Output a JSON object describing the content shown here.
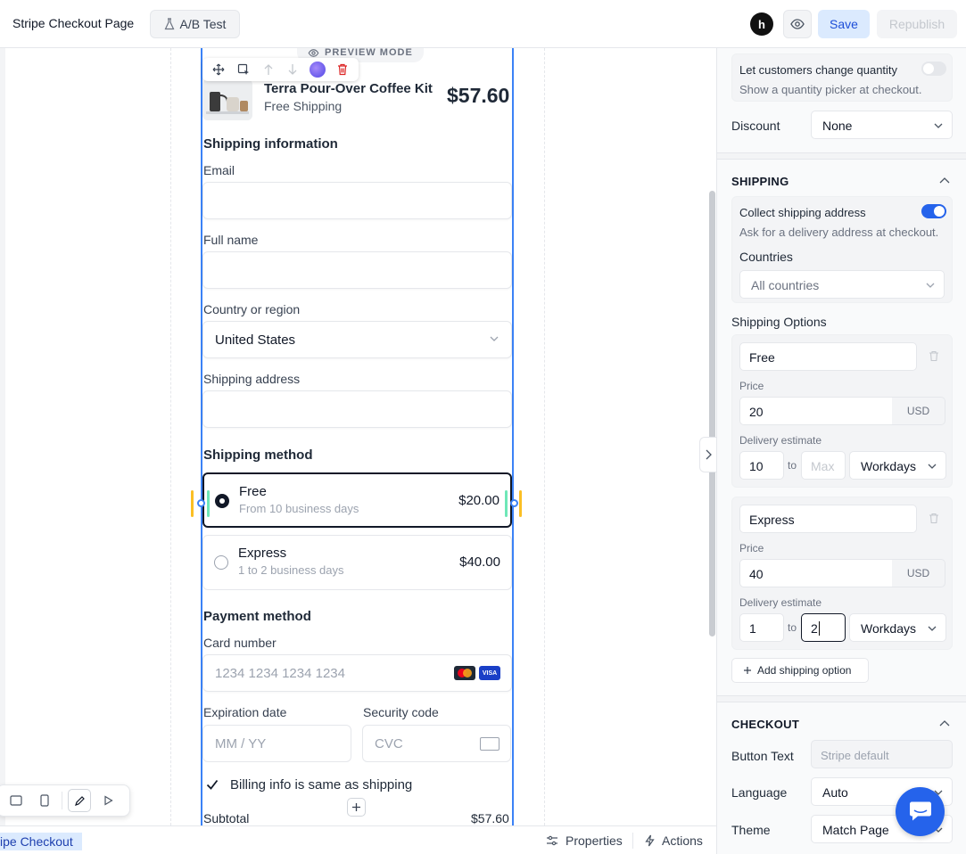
{
  "topbar": {
    "title": "Stripe Checkout Page",
    "ab_test_label": "A/B Test",
    "logo_glyph": "h",
    "save_label": "Save",
    "republish_label": "Republish"
  },
  "canvas": {
    "preview_badge": "PREVIEW MODE",
    "product": {
      "name": "Terra Pour-Over Coffee Kit",
      "subtitle": "Free Shipping",
      "price": "$57.60"
    },
    "shipping_info_heading": "Shipping information",
    "email_label": "Email",
    "email_value": "",
    "full_name_label": "Full name",
    "full_name_value": "",
    "country_label": "Country or region",
    "country_value": "United States",
    "address_label": "Shipping address",
    "address_value": "",
    "shipping_method_heading": "Shipping method",
    "shipping_options": [
      {
        "name": "Free",
        "subtitle": "From 10 business days",
        "price": "$20.00",
        "selected": true
      },
      {
        "name": "Express",
        "subtitle": "1 to 2 business days",
        "price": "$40.00",
        "selected": false
      }
    ],
    "payment_heading": "Payment method",
    "card_label": "Card number",
    "card_placeholder": "1234 1234 1234 1234",
    "visa_text": "VISA",
    "exp_label": "Expiration date",
    "exp_placeholder": "MM / YY",
    "cvc_label": "Security code",
    "cvc_placeholder": "CVC",
    "billing_same_label": "Billing info is same as shipping",
    "subtotal_label": "Subtotal",
    "subtotal_value": "$57.60"
  },
  "bottombar": {
    "breadcrumb": "ipe Checkout",
    "properties_label": "Properties",
    "actions_label": "Actions"
  },
  "panel": {
    "quantity_toggle_label": "Let customers change quantity",
    "quantity_toggle_help": "Show a quantity picker at checkout.",
    "discount_label": "Discount",
    "discount_value": "None",
    "shipping_section_title": "SHIPPING",
    "collect_shipping_label": "Collect shipping address",
    "collect_shipping_help": "Ask for a delivery address at checkout.",
    "countries_label": "Countries",
    "countries_value": "All countries",
    "shipping_options_label": "Shipping Options",
    "options": [
      {
        "name": "Free",
        "price_label": "Price",
        "price": "20",
        "currency": "USD",
        "estimate_label": "Delivery estimate",
        "min": "10",
        "to": "to",
        "max": "",
        "max_placeholder": "Max",
        "unit": "Workdays"
      },
      {
        "name": "Express",
        "price_label": "Price",
        "price": "40",
        "currency": "USD",
        "estimate_label": "Delivery estimate",
        "min": "1",
        "to": "to",
        "max": "2",
        "max_placeholder": "Max",
        "unit": "Workdays"
      }
    ],
    "add_option_label": "Add shipping option",
    "checkout_section_title": "CHECKOUT",
    "button_text_label": "Button Text",
    "button_text_placeholder": "Stripe default",
    "language_label": "Language",
    "language_value": "Auto",
    "theme_label": "Theme",
    "theme_value": "Match Page"
  },
  "colors": {
    "accent": "#2563eb",
    "selection_outline": "#3b82f6",
    "save_bg": "#dbeafe"
  }
}
